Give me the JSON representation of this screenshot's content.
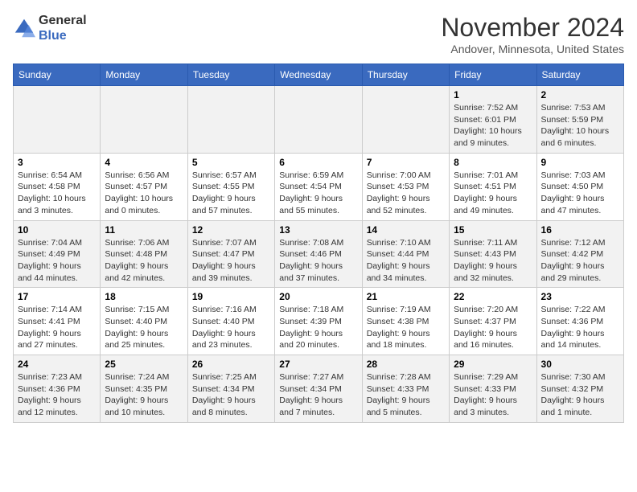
{
  "header": {
    "logo_line1": "General",
    "logo_line2": "Blue",
    "month": "November 2024",
    "location": "Andover, Minnesota, United States"
  },
  "days_of_week": [
    "Sunday",
    "Monday",
    "Tuesday",
    "Wednesday",
    "Thursday",
    "Friday",
    "Saturday"
  ],
  "weeks": [
    [
      {
        "day": "",
        "info": ""
      },
      {
        "day": "",
        "info": ""
      },
      {
        "day": "",
        "info": ""
      },
      {
        "day": "",
        "info": ""
      },
      {
        "day": "",
        "info": ""
      },
      {
        "day": "1",
        "info": "Sunrise: 7:52 AM\nSunset: 6:01 PM\nDaylight: 10 hours and 9 minutes."
      },
      {
        "day": "2",
        "info": "Sunrise: 7:53 AM\nSunset: 5:59 PM\nDaylight: 10 hours and 6 minutes."
      }
    ],
    [
      {
        "day": "3",
        "info": "Sunrise: 6:54 AM\nSunset: 4:58 PM\nDaylight: 10 hours and 3 minutes."
      },
      {
        "day": "4",
        "info": "Sunrise: 6:56 AM\nSunset: 4:57 PM\nDaylight: 10 hours and 0 minutes."
      },
      {
        "day": "5",
        "info": "Sunrise: 6:57 AM\nSunset: 4:55 PM\nDaylight: 9 hours and 57 minutes."
      },
      {
        "day": "6",
        "info": "Sunrise: 6:59 AM\nSunset: 4:54 PM\nDaylight: 9 hours and 55 minutes."
      },
      {
        "day": "7",
        "info": "Sunrise: 7:00 AM\nSunset: 4:53 PM\nDaylight: 9 hours and 52 minutes."
      },
      {
        "day": "8",
        "info": "Sunrise: 7:01 AM\nSunset: 4:51 PM\nDaylight: 9 hours and 49 minutes."
      },
      {
        "day": "9",
        "info": "Sunrise: 7:03 AM\nSunset: 4:50 PM\nDaylight: 9 hours and 47 minutes."
      }
    ],
    [
      {
        "day": "10",
        "info": "Sunrise: 7:04 AM\nSunset: 4:49 PM\nDaylight: 9 hours and 44 minutes."
      },
      {
        "day": "11",
        "info": "Sunrise: 7:06 AM\nSunset: 4:48 PM\nDaylight: 9 hours and 42 minutes."
      },
      {
        "day": "12",
        "info": "Sunrise: 7:07 AM\nSunset: 4:47 PM\nDaylight: 9 hours and 39 minutes."
      },
      {
        "day": "13",
        "info": "Sunrise: 7:08 AM\nSunset: 4:46 PM\nDaylight: 9 hours and 37 minutes."
      },
      {
        "day": "14",
        "info": "Sunrise: 7:10 AM\nSunset: 4:44 PM\nDaylight: 9 hours and 34 minutes."
      },
      {
        "day": "15",
        "info": "Sunrise: 7:11 AM\nSunset: 4:43 PM\nDaylight: 9 hours and 32 minutes."
      },
      {
        "day": "16",
        "info": "Sunrise: 7:12 AM\nSunset: 4:42 PM\nDaylight: 9 hours and 29 minutes."
      }
    ],
    [
      {
        "day": "17",
        "info": "Sunrise: 7:14 AM\nSunset: 4:41 PM\nDaylight: 9 hours and 27 minutes."
      },
      {
        "day": "18",
        "info": "Sunrise: 7:15 AM\nSunset: 4:40 PM\nDaylight: 9 hours and 25 minutes."
      },
      {
        "day": "19",
        "info": "Sunrise: 7:16 AM\nSunset: 4:40 PM\nDaylight: 9 hours and 23 minutes."
      },
      {
        "day": "20",
        "info": "Sunrise: 7:18 AM\nSunset: 4:39 PM\nDaylight: 9 hours and 20 minutes."
      },
      {
        "day": "21",
        "info": "Sunrise: 7:19 AM\nSunset: 4:38 PM\nDaylight: 9 hours and 18 minutes."
      },
      {
        "day": "22",
        "info": "Sunrise: 7:20 AM\nSunset: 4:37 PM\nDaylight: 9 hours and 16 minutes."
      },
      {
        "day": "23",
        "info": "Sunrise: 7:22 AM\nSunset: 4:36 PM\nDaylight: 9 hours and 14 minutes."
      }
    ],
    [
      {
        "day": "24",
        "info": "Sunrise: 7:23 AM\nSunset: 4:36 PM\nDaylight: 9 hours and 12 minutes."
      },
      {
        "day": "25",
        "info": "Sunrise: 7:24 AM\nSunset: 4:35 PM\nDaylight: 9 hours and 10 minutes."
      },
      {
        "day": "26",
        "info": "Sunrise: 7:25 AM\nSunset: 4:34 PM\nDaylight: 9 hours and 8 minutes."
      },
      {
        "day": "27",
        "info": "Sunrise: 7:27 AM\nSunset: 4:34 PM\nDaylight: 9 hours and 7 minutes."
      },
      {
        "day": "28",
        "info": "Sunrise: 7:28 AM\nSunset: 4:33 PM\nDaylight: 9 hours and 5 minutes."
      },
      {
        "day": "29",
        "info": "Sunrise: 7:29 AM\nSunset: 4:33 PM\nDaylight: 9 hours and 3 minutes."
      },
      {
        "day": "30",
        "info": "Sunrise: 7:30 AM\nSunset: 4:32 PM\nDaylight: 9 hours and 1 minute."
      }
    ]
  ]
}
